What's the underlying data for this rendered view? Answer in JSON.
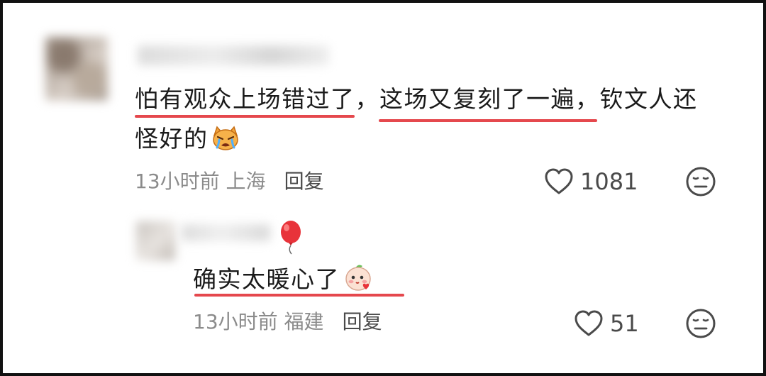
{
  "comments": [
    {
      "text_line1": "怕有观众上场错过了，这场又复刻了一遍，钦文人还",
      "text_line2": "怪好的",
      "emoji": "crying-cat-emoji",
      "time": "13小时前",
      "location": "上海",
      "reply_label": "回复",
      "likes": "1081",
      "highlighted_phrases": [
        "怕有观众上场错过了",
        "这场又复刻了一遍"
      ]
    },
    {
      "text": "确实太暖心了",
      "emoji": "blushing-peach-emoji",
      "badge_icon": "red-balloon-icon",
      "time": "13小时前",
      "location": "福建",
      "reply_label": "回复",
      "likes": "51",
      "highlighted_phrases": [
        "确实太暖心了"
      ]
    }
  ],
  "colors": {
    "underline": "#e5484d",
    "text": "#1a1a1a",
    "meta": "#8b8b8b",
    "reply": "#4a4a4a"
  }
}
